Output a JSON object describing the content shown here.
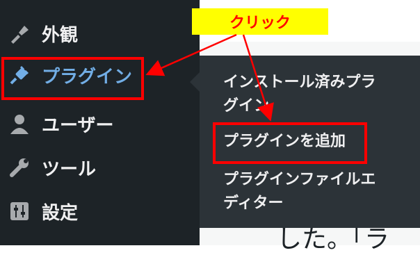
{
  "sidebar": {
    "items": [
      {
        "label": "外観",
        "icon": "paintbrush-icon",
        "active": false
      },
      {
        "label": "プラグイン",
        "icon": "plugin-plug-icon",
        "active": true
      },
      {
        "label": "ユーザー",
        "icon": "user-icon",
        "active": false
      },
      {
        "label": "ツール",
        "icon": "wrench-icon",
        "active": false
      },
      {
        "label": "設定",
        "icon": "settings-sliders-icon",
        "active": false
      }
    ]
  },
  "submenu": {
    "items": [
      {
        "label_line1": "インストール済みプラ",
        "label_line2": "グイン"
      },
      {
        "label": "プラグインを追加"
      },
      {
        "label_line1": "プラグインファイルエ",
        "label_line2": "ディター"
      }
    ]
  },
  "annotation": {
    "callout_text": "クリック",
    "color": "#ff0000",
    "callout_bg": "#ffff00"
  },
  "content": {
    "bottom_text": "した。「ラ",
    "right_char": "r"
  },
  "colors": {
    "sidebar_bg": "#1d2327",
    "submenu_bg": "#2c3338",
    "active_text": "#72aee6",
    "menu_text": "#f0f0f1"
  }
}
